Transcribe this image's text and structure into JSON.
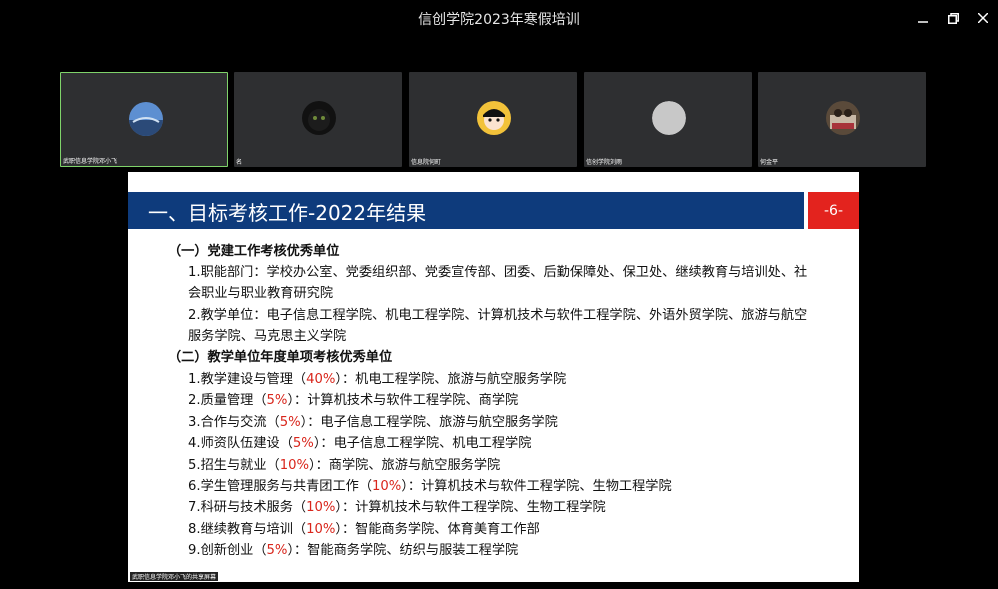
{
  "window": {
    "title": "信创学院2023年寒假培训"
  },
  "participants": [
    {
      "name": "武职信息学院邓小飞",
      "active": true
    },
    {
      "name": "名",
      "active": false
    },
    {
      "name": "信息院何町",
      "active": false
    },
    {
      "name": "信创学院刘雨",
      "active": false
    },
    {
      "name": "何金平",
      "active": false
    }
  ],
  "slide": {
    "title": "一、目标考核工作-2022年结果",
    "number": "-6-",
    "section1": {
      "heading": "（一）党建工作考核优秀单位",
      "item1_line1": "1.职能部门：学校办公室、党委组织部、党委宣传部、团委、后勤保障处、保卫处、继续教育与培训处、社",
      "item1_line2": "会职业与职业教育研究院",
      "item2_line1": "2.教学单位：电子信息工程学院、机电工程学院、计算机技术与软件工程学院、外语外贸学院、旅游与航空",
      "item2_line2": "服务学院、马克思主义学院"
    },
    "section2": {
      "heading": "（二）教学单位年度单项考核优秀单位",
      "items": [
        {
          "pre": "1.教学建设与管理（",
          "pct": "40%",
          "post": "）：机电工程学院、旅游与航空服务学院"
        },
        {
          "pre": "2.质量管理（",
          "pct": "5%",
          "post": "）：计算机技术与软件工程学院、商学院"
        },
        {
          "pre": "3.合作与交流（",
          "pct": "5%",
          "post": "）：电子信息工程学院、旅游与航空服务学院"
        },
        {
          "pre": "4.师资队伍建设（",
          "pct": "5%",
          "post": "）：电子信息工程学院、机电工程学院"
        },
        {
          "pre": "5.招生与就业（",
          "pct": "10%",
          "post": "）：商学院、旅游与航空服务学院"
        },
        {
          "pre": "6.学生管理服务与共青团工作（",
          "pct": "10%",
          "post": "）：计算机技术与软件工程学院、生物工程学院"
        },
        {
          "pre": "7.科研与技术服务（",
          "pct": "10%",
          "post": "）：计算机技术与软件工程学院、生物工程学院"
        },
        {
          "pre": "8.继续教育与培训（",
          "pct": "10%",
          "post": "）：智能商务学院、体育美育工作部"
        },
        {
          "pre": "9.创新创业（",
          "pct": "5%",
          "post": "）：智能商务学院、纺织与服装工程学院"
        }
      ]
    },
    "share_label": "武职信息学院邓小飞的共享屏幕"
  },
  "colors": {
    "header_blue": "#0e3b7c",
    "number_red": "#e3231e",
    "percent_red": "#d9261c",
    "active_border": "#7fd36a"
  }
}
